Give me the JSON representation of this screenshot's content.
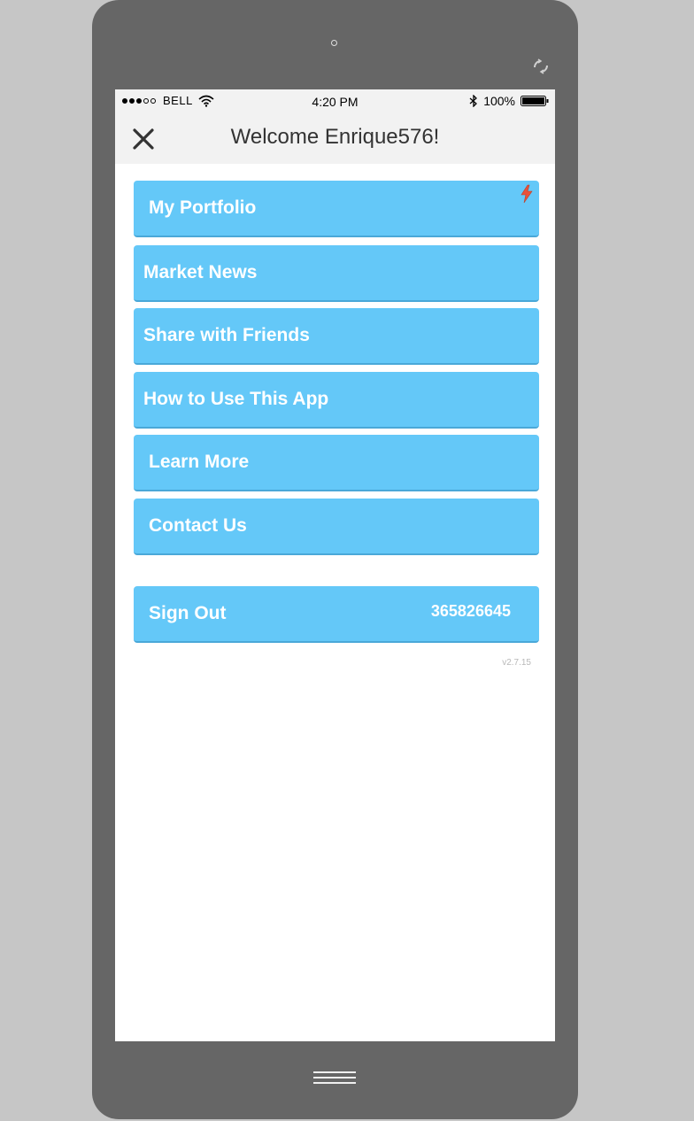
{
  "colors": {
    "background": "#c6c6c6",
    "frame": "#666666",
    "accent": "#64c8f8",
    "badge": "#e8523a"
  },
  "status_bar": {
    "carrier": "BELL",
    "time": "4:20 PM",
    "battery": "100%",
    "signal_bars": 3,
    "signal_total": 5
  },
  "header": {
    "title": "Welcome Enrique576!",
    "close_icon": "close-icon"
  },
  "menu": {
    "items": [
      {
        "label": "My Portfolio",
        "icon": "flash-icon"
      },
      {
        "label": "Market News"
      },
      {
        "label": "Share with Friends"
      },
      {
        "label": "How to Use This App"
      },
      {
        "label": "Learn More"
      },
      {
        "label": "Contact Us"
      }
    ],
    "sign_out": {
      "label": "Sign Out",
      "account_id": "365826645"
    }
  },
  "version": "v2.7.15"
}
